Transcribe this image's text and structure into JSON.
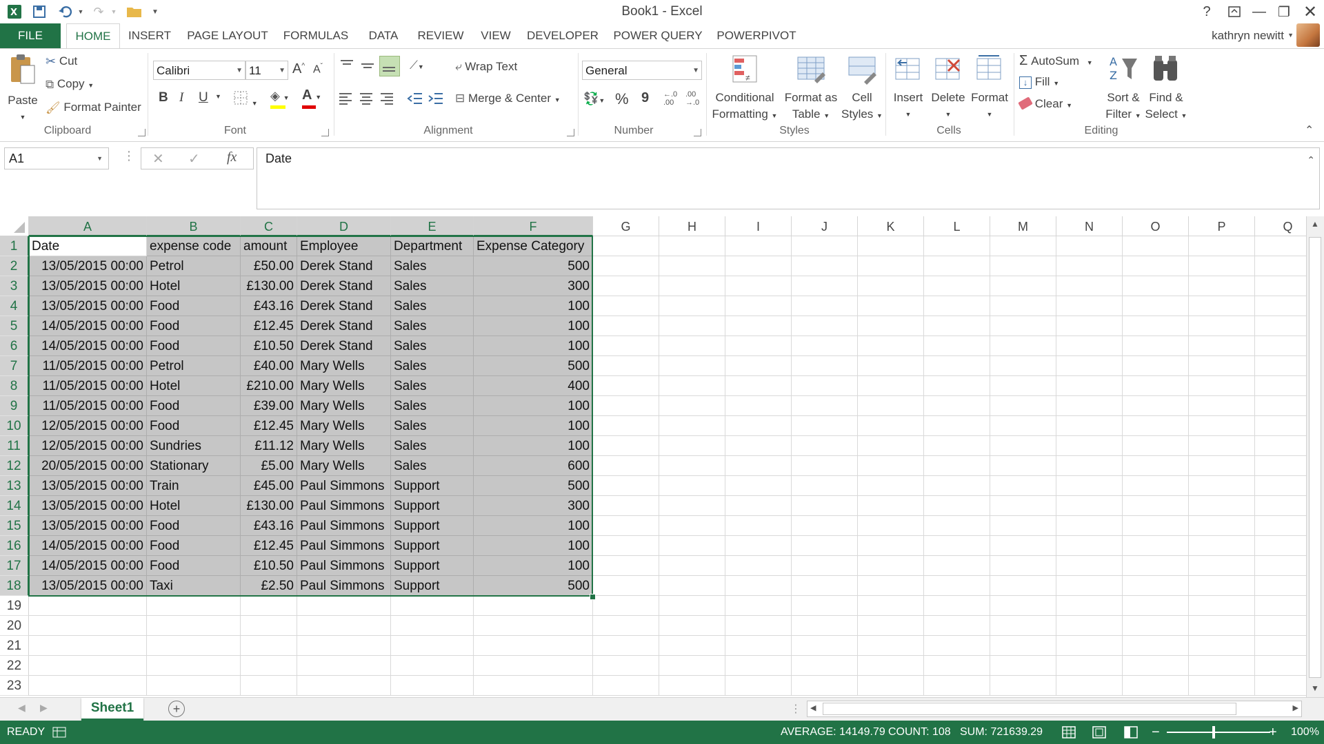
{
  "window": {
    "title": "Book1 - Excel",
    "user": "kathryn newitt"
  },
  "quick_access": [
    "excel-logo-icon",
    "save-icon",
    "undo-icon",
    "redo-icon",
    "open-folder-icon",
    "customize-icon"
  ],
  "tabs": [
    "FILE",
    "HOME",
    "INSERT",
    "PAGE LAYOUT",
    "FORMULAS",
    "DATA",
    "REVIEW",
    "VIEW",
    "DEVELOPER",
    "POWER QUERY",
    "POWERPIVOT"
  ],
  "ribbon": {
    "clipboard": {
      "label": "Clipboard",
      "paste": "Paste",
      "cut": "Cut",
      "copy": "Copy",
      "format_painter": "Format Painter"
    },
    "font": {
      "label": "Font",
      "name": "Calibri",
      "size": "11",
      "bold": "B",
      "italic": "I",
      "underline": "U"
    },
    "alignment": {
      "label": "Alignment",
      "wrap_text": "Wrap Text",
      "merge_center": "Merge & Center"
    },
    "number": {
      "label": "Number",
      "format": "General",
      "percent": "%",
      "comma": "9"
    },
    "styles": {
      "label": "Styles",
      "conditional_1": "Conditional",
      "conditional_2": "Formatting",
      "format_table_1": "Format as",
      "format_table_2": "Table",
      "cell_styles_1": "Cell",
      "cell_styles_2": "Styles"
    },
    "cells": {
      "label": "Cells",
      "insert": "Insert",
      "delete": "Delete",
      "format": "Format"
    },
    "editing": {
      "label": "Editing",
      "autosum": "AutoSum",
      "fill": "Fill",
      "clear": "Clear",
      "sort_1": "Sort &",
      "sort_2": "Filter",
      "find_1": "Find &",
      "find_2": "Select"
    }
  },
  "formula_bar": {
    "name_box": "A1",
    "fx": "fx",
    "content": "Date"
  },
  "columns": [
    "A",
    "B",
    "C",
    "D",
    "E",
    "F",
    "G",
    "H",
    "I",
    "J",
    "K",
    "L",
    "M",
    "N",
    "O",
    "P",
    "Q"
  ],
  "row_numbers": [
    "1",
    "2",
    "3",
    "4",
    "5",
    "6",
    "7",
    "8",
    "9",
    "10",
    "11",
    "12",
    "13",
    "14",
    "15",
    "16",
    "17",
    "18",
    "19",
    "20",
    "21",
    "22",
    "23"
  ],
  "table": {
    "headers": [
      "Date",
      "expense code",
      "amount",
      "Employee",
      "Department",
      "Expense Category"
    ],
    "rows": [
      [
        "13/05/2015 00:00",
        "Petrol",
        "£50.00",
        "Derek Stand",
        "Sales",
        "500"
      ],
      [
        "13/05/2015 00:00",
        "Hotel",
        "£130.00",
        "Derek Stand",
        "Sales",
        "300"
      ],
      [
        "13/05/2015 00:00",
        "Food",
        "£43.16",
        "Derek Stand",
        "Sales",
        "100"
      ],
      [
        "14/05/2015 00:00",
        "Food",
        "£12.45",
        "Derek Stand",
        "Sales",
        "100"
      ],
      [
        "14/05/2015 00:00",
        "Food",
        "£10.50",
        "Derek Stand",
        "Sales",
        "100"
      ],
      [
        "11/05/2015 00:00",
        "Petrol",
        "£40.00",
        "Mary Wells",
        "Sales",
        "500"
      ],
      [
        "11/05/2015 00:00",
        "Hotel",
        "£210.00",
        "Mary Wells",
        "Sales",
        "400"
      ],
      [
        "11/05/2015 00:00",
        "Food",
        "£39.00",
        "Mary Wells",
        "Sales",
        "100"
      ],
      [
        "12/05/2015 00:00",
        "Food",
        "£12.45",
        "Mary Wells",
        "Sales",
        "100"
      ],
      [
        "12/05/2015 00:00",
        "Sundries",
        "£11.12",
        "Mary Wells",
        "Sales",
        "100"
      ],
      [
        "20/05/2015 00:00",
        "Stationary",
        "£5.00",
        "Mary Wells",
        "Sales",
        "600"
      ],
      [
        "13/05/2015 00:00",
        "Train",
        "£45.00",
        "Paul Simmons",
        "Support",
        "500"
      ],
      [
        "13/05/2015 00:00",
        "Hotel",
        "£130.00",
        "Paul Simmons",
        "Support",
        "300"
      ],
      [
        "13/05/2015 00:00",
        "Food",
        "£43.16",
        "Paul Simmons",
        "Support",
        "100"
      ],
      [
        "14/05/2015 00:00",
        "Food",
        "£12.45",
        "Paul Simmons",
        "Support",
        "100"
      ],
      [
        "14/05/2015 00:00",
        "Food",
        "£10.50",
        "Paul Simmons",
        "Support",
        "100"
      ],
      [
        "13/05/2015 00:00",
        "Taxi",
        "£2.50",
        "Paul Simmons",
        "Support",
        "500"
      ]
    ]
  },
  "sheet_tab": "Sheet1",
  "status": {
    "mode": "READY",
    "average": "AVERAGE: 14149.79",
    "count": "COUNT: 108",
    "sum": "SUM: 721639.29",
    "zoom": "100%"
  },
  "colors": {
    "accent": "#217346",
    "selection": "#c6c6c6"
  }
}
